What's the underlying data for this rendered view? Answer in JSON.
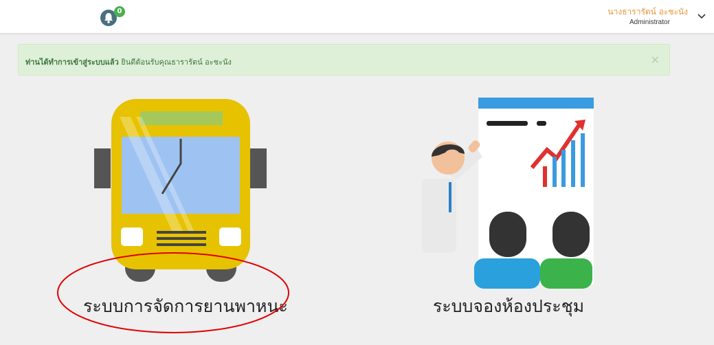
{
  "header": {
    "notification_count": "0",
    "user_name": "นางธารารัตน์ อะชะนัง",
    "user_role": "Administrator"
  },
  "alert": {
    "message_bold": "ท่านได้ทำการเข้าสู่ระบบแล้ว",
    "message": " ยินดีต้อนรับคุณธารารัตน์ อะชะนัง",
    "close_glyph": "×"
  },
  "modules": [
    {
      "label": "ระบบการจัดการยานพาหนะ",
      "icon": "bus-icon"
    },
    {
      "label": "ระบบจองห้องประชุม",
      "icon": "meeting-presentation-icon"
    }
  ],
  "colors": {
    "user_name": "#e8963c",
    "badge": "#4caf50",
    "alert_bg": "#dff0d8",
    "bus_body": "#e6c200",
    "highlight": "#e00000"
  }
}
